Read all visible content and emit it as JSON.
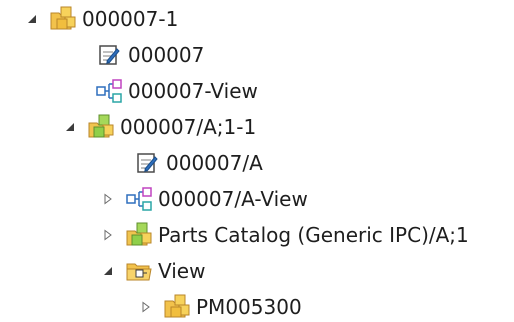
{
  "tree": {
    "nodes": [
      {
        "label": "000007-1",
        "icon": "yellow-folder-cube-icon",
        "expander": "expanded"
      },
      {
        "label": "000007",
        "icon": "document-edit-icon",
        "expander": "none"
      },
      {
        "label": "000007-View",
        "icon": "view-structure-icon",
        "expander": "none"
      },
      {
        "label": "000007/A;1-1",
        "icon": "green-folder-cube-icon",
        "expander": "expanded"
      },
      {
        "label": "000007/A",
        "icon": "document-edit-icon",
        "expander": "none"
      },
      {
        "label": "000007/A-View",
        "icon": "view-structure-icon",
        "expander": "collapsed"
      },
      {
        "label": "Parts Catalog (Generic IPC)/A;1",
        "icon": "green-folder-cube-icon",
        "expander": "collapsed"
      },
      {
        "label": "View",
        "icon": "view-folder-icon",
        "expander": "expanded"
      },
      {
        "label": "PM005300",
        "icon": "yellow-folder-cube-icon",
        "expander": "collapsed"
      }
    ]
  }
}
